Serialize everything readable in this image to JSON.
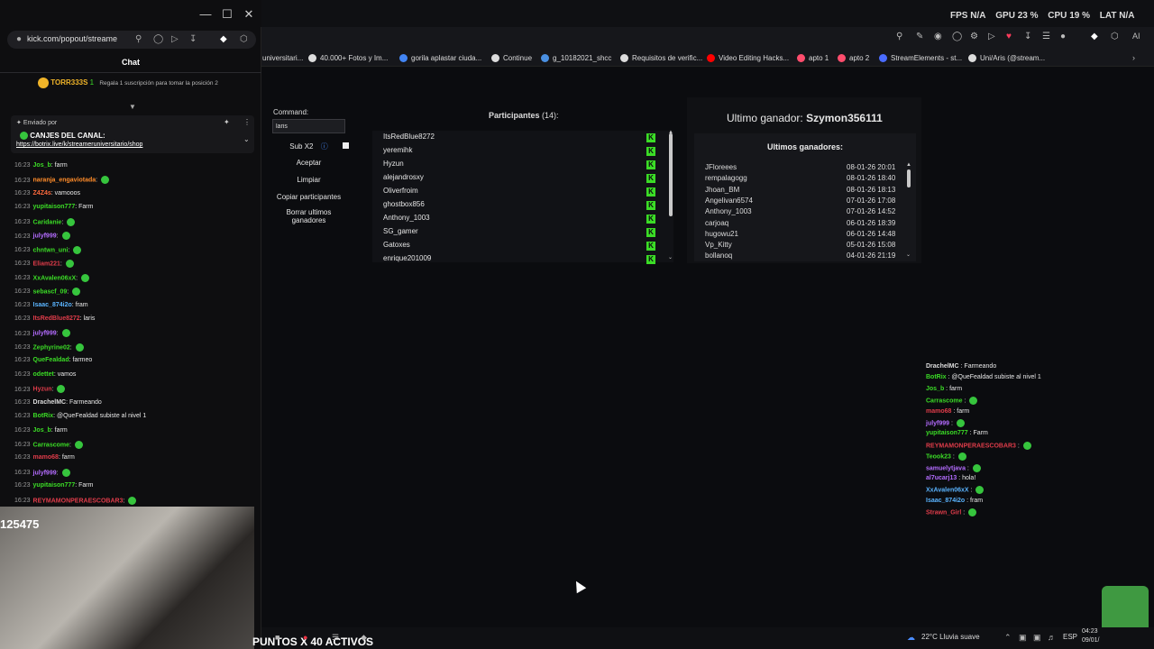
{
  "popout": {
    "url": "kick.com/popout/streame",
    "chat_title": "Chat",
    "top_gifter": {
      "name": "TORR333S",
      "count": "1",
      "cta": "Regala 1 suscripción para tomar la posición 2"
    },
    "pinned": {
      "sent_by": "Enviado por",
      "title": "CANJES DEL CANAL:",
      "link": "https://botrix.live/k/streameruniversitario/shop"
    },
    "messages": [
      {
        "time": "16:23",
        "user": "Jos_b",
        "text": "farm",
        "color": "#3bdc26"
      },
      {
        "time": "16:23",
        "user": "naranja_engaviotada",
        "text": "",
        "color": "#ff8c2a"
      },
      {
        "time": "16:23",
        "user": "Z4Z4s",
        "text": "vamooos",
        "color": "#ff6a3d"
      },
      {
        "time": "16:23",
        "user": "yupitaison777",
        "text": "Farm",
        "color": "#3bdc26"
      },
      {
        "time": "16:23",
        "user": "Caridanie",
        "text": "",
        "color": "#3bdc26"
      },
      {
        "time": "16:23",
        "user": "julyf999",
        "text": "",
        "color": "#b46cff"
      },
      {
        "time": "16:23",
        "user": "chntwn_uni",
        "text": "",
        "color": "#3bdc26"
      },
      {
        "time": "16:23",
        "user": "Eliam221",
        "text": "",
        "color": "#e03c4a"
      },
      {
        "time": "16:23",
        "user": "XxAvalen06xX",
        "text": "",
        "color": "#3bdc26"
      },
      {
        "time": "16:23",
        "user": "sebascf_09",
        "text": "",
        "color": "#3bdc26"
      },
      {
        "time": "16:23",
        "user": "Isaac_874i2o",
        "text": "fram",
        "color": "#5ab4ff"
      },
      {
        "time": "16:23",
        "user": "ItsRedBlue8272",
        "text": "laris",
        "color": "#e03c4a"
      },
      {
        "time": "16:23",
        "user": "julyf999",
        "text": "",
        "color": "#b46cff"
      },
      {
        "time": "16:23",
        "user": "Zephyrine02",
        "text": "",
        "color": "#3bdc26"
      },
      {
        "time": "16:23",
        "user": "QueFealdad",
        "text": "farmeo",
        "color": "#3bdc26"
      },
      {
        "time": "16:23",
        "user": "odettet",
        "text": "vamos",
        "color": "#3bdc26"
      },
      {
        "time": "16:23",
        "user": "Hyzun",
        "text": "",
        "color": "#e03c4a"
      },
      {
        "time": "16:23",
        "user": "DrachelMC",
        "text": "Farmeando",
        "color": "#dddddd"
      },
      {
        "time": "16:23",
        "user": "BotRix",
        "text": "@QueFealdad subiste al nivel 1",
        "color": "#3bdc26"
      },
      {
        "time": "16:23",
        "user": "Jos_b",
        "text": "farm",
        "color": "#3bdc26"
      },
      {
        "time": "16:23",
        "user": "Carrascome",
        "text": "",
        "color": "#3bdc26"
      },
      {
        "time": "16:23",
        "user": "mamo68",
        "text": "farm",
        "color": "#e03c4a"
      },
      {
        "time": "16:23",
        "user": "julyf999",
        "text": "",
        "color": "#b46cff"
      },
      {
        "time": "16:23",
        "user": "yupitaison777",
        "text": "Farm",
        "color": "#3bdc26"
      },
      {
        "time": "16:23",
        "user": "REYMAMONPERAESCOBAR3",
        "text": "",
        "color": "#e03c4a"
      }
    ],
    "cam_badge": "125475"
  },
  "stats": {
    "fps_label": "FPS",
    "fps": "N/A",
    "gpu_label": "GPU",
    "gpu": "23 %",
    "cpu_label": "CPU",
    "cpu": "19 %",
    "lat_label": "LAT",
    "lat": "N/A"
  },
  "bookmarks": [
    {
      "label": "universitari...",
      "color": "#888"
    },
    {
      "label": "40.000+ Fotos y Im...",
      "color": "#ddd"
    },
    {
      "label": "gorila aplastar ciuda...",
      "color": "#4285f4"
    },
    {
      "label": "Continue",
      "color": "#ddd"
    },
    {
      "label": "g_10182021_shcc",
      "color": "#4a90e2"
    },
    {
      "label": "Requisitos de verific...",
      "color": "#ddd"
    },
    {
      "label": "Video Editing Hacks...",
      "color": "#ff0000"
    },
    {
      "label": "apto 1",
      "color": "#ff4d6d"
    },
    {
      "label": "apto 2",
      "color": "#ff4d6d"
    },
    {
      "label": "StreamElements - st...",
      "color": "#4a6cff"
    },
    {
      "label": "Uni/Aris (@stream...",
      "color": "#ddd"
    }
  ],
  "giveaway": {
    "command_label": "Command:",
    "command_value": "laris",
    "sub_label": "Sub X2",
    "accept": "Aceptar",
    "clear": "Limpiar",
    "copy": "Copiar participantes",
    "delete_winners": "Borrar ultimos ganadores",
    "participants_title": "Participantes",
    "participants_count": "(14):",
    "participants": [
      "ItsRedBlue8272",
      "yeremihk",
      "Hyzun",
      "alejandrosxy",
      "Oliverfroim",
      "ghostbox856",
      "Anthony_1003",
      "SG_gamer",
      "Gatoxes",
      "enrique201009"
    ],
    "last_winner_label": "Ultimo ganador:",
    "last_winner": "Szymon356111",
    "winners_title": "Ultimos ganadores:",
    "winners": [
      {
        "name": "JFloreees",
        "date": "08-01-26 20:01"
      },
      {
        "name": "rempalagogg",
        "date": "08-01-26 18:40"
      },
      {
        "name": "Jhoan_BM",
        "date": "08-01-26 18:13"
      },
      {
        "name": "Angelivan6574",
        "date": "07-01-26 17:08"
      },
      {
        "name": "Anthony_1003",
        "date": "07-01-26 14:52"
      },
      {
        "name": "carjoaq",
        "date": "06-01-26 18:39"
      },
      {
        "name": "hugowu21",
        "date": "06-01-26 14:48"
      },
      {
        "name": "Vp_Kitty",
        "date": "05-01-26 15:08"
      },
      {
        "name": "bollanoq",
        "date": "04-01-26 21:19"
      }
    ]
  },
  "overlay_chat": [
    {
      "user": "DrachelMC",
      "text": "Farmeando",
      "color": "#dddddd"
    },
    {
      "user": "BotRix",
      "text": "@QueFealdad subiste al nivel 1",
      "color": "#3bdc26"
    },
    {
      "user": "Jos_b",
      "text": "farm",
      "color": "#3bdc26"
    },
    {
      "user": "Carrascome",
      "text": "",
      "color": "#3bdc26"
    },
    {
      "user": "mamo68",
      "text": "farm",
      "color": "#e03c4a"
    },
    {
      "user": "julyf999",
      "text": "",
      "color": "#b46cff"
    },
    {
      "user": "yupitaison777",
      "text": "Farm",
      "color": "#3bdc26"
    },
    {
      "user": "REYMAMONPERAESCOBAR3",
      "text": "",
      "color": "#e03c4a"
    },
    {
      "user": "Teook23",
      "text": "",
      "color": "#3bdc26"
    },
    {
      "user": "samuelytjava",
      "text": "",
      "color": "#b46cff"
    },
    {
      "user": "al7ucarj13",
      "text": "hola!",
      "color": "#b46cff"
    },
    {
      "user": "XxAvalen06xX",
      "text": "",
      "color": "#5ab4ff"
    },
    {
      "user": "Isaac_874i2o",
      "text": "fram",
      "color": "#5ab4ff"
    },
    {
      "user": "Strawn_Girl",
      "text": "",
      "color": "#e03c4a"
    }
  ],
  "taskbar": {
    "ticker": "PUNTOS X 40 ACTIVOS",
    "weather": "22°C  Lluvia suave",
    "lang": "ESP",
    "time": "04:23",
    "date": "09/01/"
  }
}
